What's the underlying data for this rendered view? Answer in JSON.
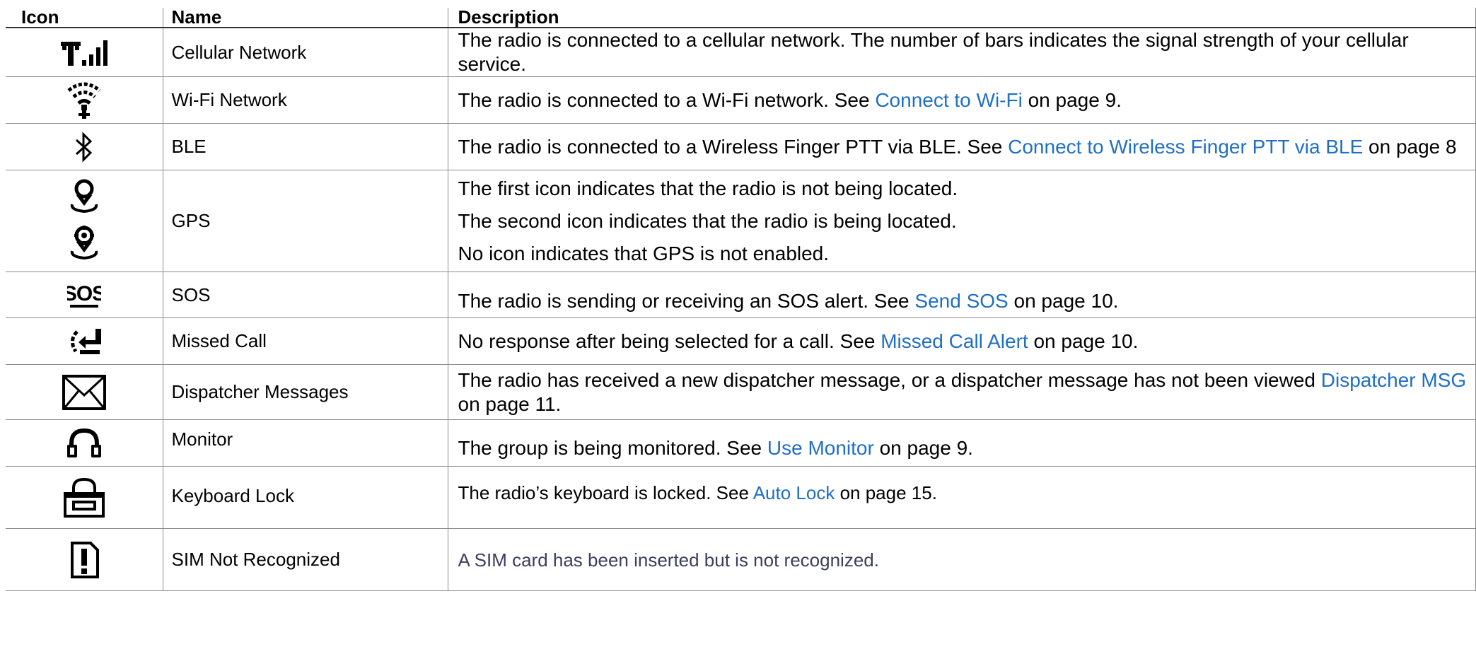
{
  "headers": {
    "icon": "Icon",
    "name": "Name",
    "description": "Description"
  },
  "rows": [
    {
      "icon": "cellular-signal-icon",
      "name": "Cellular Network",
      "text": "The radio is connected to a cellular network. The number of bars indicates the signal strength of your cellular service."
    },
    {
      "icon": "wifi-icon",
      "name": "Wi-Fi Network",
      "pre": "The radio is connected to a Wi-Fi network. See ",
      "link": "Connect to Wi-Fi",
      "post": " on page 9."
    },
    {
      "icon": "bluetooth-icon",
      "name": "BLE",
      "pre": "The radio is connected to a Wireless Finger PTT via BLE. See ",
      "link": "Connect to Wireless Finger PTT via BLE",
      "post": " on page 8"
    },
    {
      "icon": "gps-location-icon",
      "name": "GPS",
      "lines": [
        "The first icon indicates that the radio is not being located.",
        "The second icon indicates that the radio is being located.",
        "No icon indicates that GPS is not enabled."
      ]
    },
    {
      "icon": "sos-icon",
      "name": "SOS",
      "pre": "The radio is sending or receiving an SOS alert. See ",
      "link": "Send SOS",
      "post": " on page 10."
    },
    {
      "icon": "missed-call-icon",
      "name": "Missed Call",
      "pre": "No response after being selected for a call. See ",
      "link": "Missed Call Alert",
      "post": " on page 10."
    },
    {
      "icon": "envelope-icon",
      "name": "Dispatcher Messages",
      "pre": "The radio has received a new dispatcher message, or a dispatcher message has not been viewed ",
      "link": "Dispatcher MSG",
      "post": " on page 11."
    },
    {
      "icon": "headphones-icon",
      "name": "Monitor",
      "pre": "The group is being monitored. See ",
      "link": "Use Monitor",
      "post": " on page 9."
    },
    {
      "icon": "keyboard-lock-icon",
      "name": "Keyboard Lock",
      "pre": "The radio’s keyboard is locked. See ",
      "link": "Auto Lock",
      "post": " on page 15."
    },
    {
      "icon": "sim-alert-icon",
      "name": "SIM Not Recognized",
      "text": "A SIM card has been inserted but is not recognized."
    }
  ],
  "colors": {
    "link": "#1f6fc5",
    "border": "#8c8c8c",
    "muted_text": "#3a3f5c"
  }
}
